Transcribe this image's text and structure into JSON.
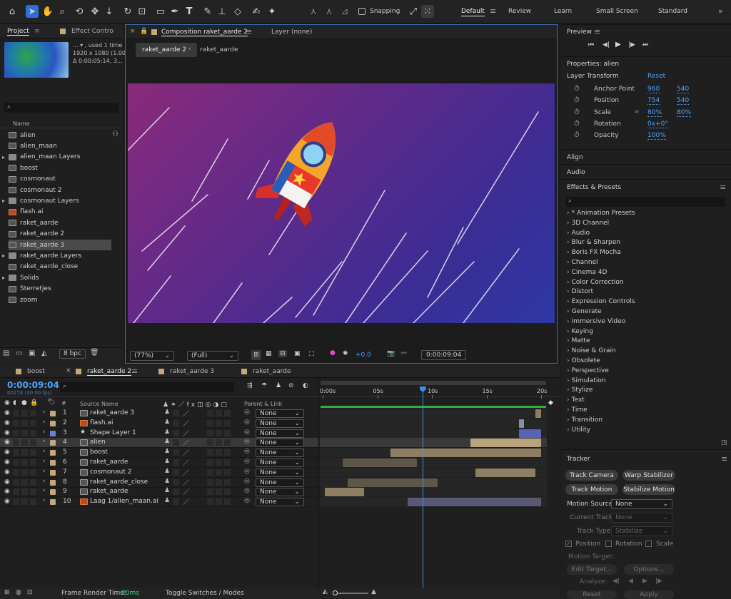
{
  "toolbar": {
    "snapping": "Snapping",
    "workspaces": [
      "Default",
      "Review",
      "Learn",
      "Small Screen",
      "Standard"
    ]
  },
  "project": {
    "tabs": [
      "Project",
      "Effect Contro"
    ],
    "info": {
      "line1": "... ▾ , used 1 time",
      "line2": "1920 x 1080 (1.00)",
      "line3": "Δ 0:00:05:14, 3..."
    },
    "column": "Name",
    "bpc": "8 bpc",
    "items": [
      {
        "name": "alien",
        "type": "comp",
        "folder": false
      },
      {
        "name": "alien_maan",
        "type": "comp",
        "folder": false
      },
      {
        "name": "alien_maan Layers",
        "type": "folder",
        "folder": true
      },
      {
        "name": "boost",
        "type": "comp",
        "folder": false
      },
      {
        "name": "cosmonaut",
        "type": "comp",
        "folder": false
      },
      {
        "name": "cosmonaut 2",
        "type": "comp",
        "folder": false
      },
      {
        "name": "cosmonaut Layers",
        "type": "folder",
        "folder": true
      },
      {
        "name": "flash.ai",
        "type": "ai",
        "folder": false
      },
      {
        "name": "raket_aarde",
        "type": "comp",
        "folder": false
      },
      {
        "name": "raket_aarde 2",
        "type": "comp",
        "folder": false
      },
      {
        "name": "raket_aarde 3",
        "type": "comp",
        "folder": false,
        "selected": true
      },
      {
        "name": "raket_aarde Layers",
        "type": "folder",
        "folder": true
      },
      {
        "name": "raket_aarde_close",
        "type": "comp",
        "folder": false
      },
      {
        "name": "Solids",
        "type": "folder",
        "folder": true
      },
      {
        "name": "Sterretjes",
        "type": "comp",
        "folder": false
      },
      {
        "name": "zoom",
        "type": "comp",
        "folder": false
      }
    ]
  },
  "comp": {
    "tab": "Composition raket_aarde 2",
    "layer_tab": "Layer (none)",
    "crumb_active": "raket_aarde 2",
    "crumb_next": "raket_aarde",
    "zoom": "(77%)",
    "resolution": "(Full)",
    "exposure": "+0.0",
    "timecode": "0:00:09:04"
  },
  "preview": {
    "title": "Preview"
  },
  "properties": {
    "title": "Properties: alien",
    "section": "Layer Transform",
    "reset": "Reset",
    "rows": [
      {
        "label": "Anchor Point",
        "v1": "960",
        "v2": "540"
      },
      {
        "label": "Position",
        "v1": "754",
        "v2": "540"
      },
      {
        "label": "Scale",
        "v1": "80%",
        "v2": "80%"
      },
      {
        "label": "Rotation",
        "v1": "0x+0°",
        "v2": ""
      },
      {
        "label": "Opacity",
        "v1": "100%",
        "v2": ""
      }
    ]
  },
  "align": "Align",
  "audio": "Audio",
  "effects": {
    "title": "Effects & Presets",
    "items": [
      "* Animation Presets",
      "3D Channel",
      "Audio",
      "Blur & Sharpen",
      "Boris FX Mocha",
      "Channel",
      "Cinema 4D",
      "Color Correction",
      "Distort",
      "Expression Controls",
      "Generate",
      "Immersive Video",
      "Keying",
      "Matte",
      "Noise & Grain",
      "Obsolete",
      "Perspective",
      "Simulation",
      "Stylize",
      "Text",
      "Time",
      "Transition",
      "Utility"
    ]
  },
  "tracker": {
    "title": "Tracker",
    "buttons": [
      "Track Camera",
      "Warp Stabilizer",
      "Track Motion",
      "Stabilize Motion"
    ],
    "motion_source_label": "Motion Source:",
    "motion_source": "None",
    "current_track_label": "Current Track:",
    "current_track": "None",
    "track_type_label": "Track Type:",
    "track_type": "Stabilize",
    "position": "Position",
    "rotation": "Rotation",
    "scale": "Scale",
    "motion_target": "Motion Target:",
    "edit_target": "Edit Target...",
    "options": "Options...",
    "analyze": "Analyze:",
    "reset": "Reset",
    "apply": "Apply"
  },
  "timeline": {
    "tabs": [
      "boost",
      "raket_aarde 2",
      "raket_aarde 3",
      "raket_aarde"
    ],
    "timecode": "0:00:09:04",
    "fps": "00274 (30.00 fps)",
    "col_source": "Source Name",
    "col_parent": "Parent & Link",
    "ruler": [
      "0:00s",
      "05s",
      "10s",
      "15s",
      "20s"
    ],
    "playhead_seconds": 9.13,
    "duration_seconds": 20,
    "layers": [
      {
        "num": "1",
        "name": "raket_aarde 3",
        "parent": "None",
        "color": "#c4a77a",
        "kind": "comp",
        "bar_start": 19.5,
        "bar_end": 20,
        "bar_color": "#8e7f63"
      },
      {
        "num": "2",
        "name": "flash.ai",
        "parent": "None",
        "color": "#c4a77a",
        "kind": "ai",
        "bar_start": 18.0,
        "bar_end": 18.4,
        "bar_color": "#8a8fa8"
      },
      {
        "num": "3",
        "name": "Shape Layer 1",
        "parent": "None",
        "color": "#6c7fd8",
        "kind": "shape",
        "bar_start": 18.0,
        "bar_end": 20,
        "bar_color": "#5663b8"
      },
      {
        "num": "4",
        "name": "alien",
        "parent": "None",
        "color": "#c4a77a",
        "kind": "comp",
        "bar_start": 13.5,
        "bar_end": 20,
        "bar_color": "#b8a37c",
        "selected": true
      },
      {
        "num": "5",
        "name": "boost",
        "parent": "None",
        "color": "#c4a77a",
        "kind": "comp",
        "bar_start": 6.2,
        "bar_end": 20,
        "bar_color": "#8e7f63"
      },
      {
        "num": "6",
        "name": "raket_aarde",
        "parent": "None",
        "color": "#c4a77a",
        "kind": "comp",
        "bar_start": 1.8,
        "bar_end": 8.6,
        "bar_color": "#5e5648"
      },
      {
        "num": "7",
        "name": "cosmonaut 2",
        "parent": "None",
        "color": "#c4a77a",
        "kind": "comp",
        "bar_start": 14.0,
        "bar_end": 19.5,
        "bar_color": "#8e7f63"
      },
      {
        "num": "8",
        "name": "raket_aarde_close",
        "parent": "None",
        "color": "#c4a77a",
        "kind": "comp",
        "bar_start": 2.3,
        "bar_end": 10.5,
        "bar_color": "#5e5648"
      },
      {
        "num": "9",
        "name": "raket_aarde",
        "parent": "None",
        "color": "#c4a77a",
        "kind": "comp",
        "bar_start": 0.2,
        "bar_end": 3.8,
        "bar_color": "#8e7f63"
      },
      {
        "num": "10",
        "name": "Laag 1/alien_maan.ai",
        "parent": "None",
        "color": "#c4a77a",
        "kind": "ai",
        "bar_start": 7.8,
        "bar_end": 20,
        "bar_color": "#585874"
      }
    ]
  },
  "status": {
    "frame_render_label": "Frame Render Time:",
    "frame_render_value": "20ms",
    "toggle": "Toggle Switches / Modes"
  },
  "colors": {
    "accent": "#4aa3ff",
    "selection": "#4a4a4a",
    "comp_border": "#3a6fb5",
    "green_bar": "#2eae3a"
  }
}
